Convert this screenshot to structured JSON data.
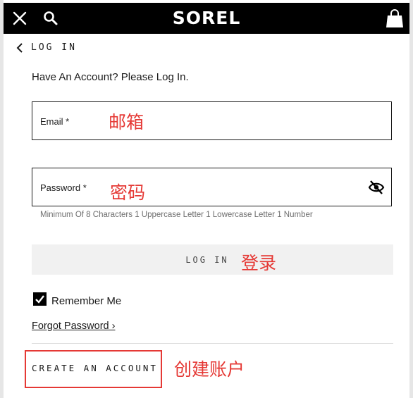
{
  "header": {
    "logo": "SOREL",
    "icons": [
      "close-icon",
      "search-icon",
      "shopping-bag-icon"
    ],
    "background": "#000000"
  },
  "back_label": "LOG IN",
  "intro": "Have An Account? Please Log In.",
  "email": {
    "label": "Email *",
    "annotation": "邮箱"
  },
  "password": {
    "label": "Password *",
    "annotation": "密码",
    "hint": "Minimum Of 8 Characters 1 Uppercase Letter 1 Lowercase Letter 1 Number"
  },
  "login_button": {
    "label": "LOG IN",
    "annotation": "登录"
  },
  "remember_me": {
    "label": "Remember Me",
    "checked": true
  },
  "forgot_password": "Forgot Password ›",
  "create_account": {
    "label": "CREATE AN ACCOUNT",
    "annotation": "创建账户"
  },
  "colors": {
    "annotation": "#e53935",
    "button_bg": "#f1f1f1"
  }
}
